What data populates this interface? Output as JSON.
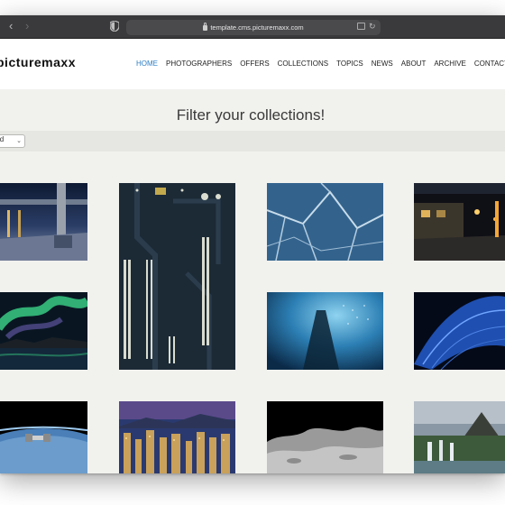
{
  "browser": {
    "url": "template.cms.picturemaxx.com",
    "icons": [
      "back-icon",
      "forward-icon",
      "shield-icon",
      "lock-icon",
      "translate-icon",
      "reload-icon"
    ]
  },
  "site": {
    "logo": "picturemaxx",
    "nav": [
      {
        "label": "HOME",
        "active": true
      },
      {
        "label": "PHOTOGRAPHERS",
        "active": false
      },
      {
        "label": "OFFERS",
        "active": false
      },
      {
        "label": "COLLECTIONS",
        "active": false
      },
      {
        "label": "TOPICS",
        "active": false
      },
      {
        "label": "NEWS",
        "active": false
      },
      {
        "label": "ABOUT",
        "active": false
      },
      {
        "label": "ARCHIVE",
        "active": false
      },
      {
        "label": "CONTACT",
        "active": false
      }
    ],
    "accent_color": "#2b7ec4"
  },
  "hero": {
    "title": "Filter your collections!"
  },
  "filter": {
    "selected": "ld"
  },
  "gallery": {
    "images": [
      {
        "subject": "industrial structure at night"
      },
      {
        "subject": "circuit board close-up"
      },
      {
        "subject": "cracked blue ice"
      },
      {
        "subject": "night street with warehouse"
      },
      {
        "subject": "aurora borealis over water"
      },
      {
        "subject": "underwater blue"
      },
      {
        "subject": "blue feather"
      },
      {
        "subject": "earth from space with satellite"
      },
      {
        "subject": "city skyline at night"
      },
      {
        "subject": "lunar surface"
      },
      {
        "subject": "waterfall and mountain"
      }
    ]
  }
}
